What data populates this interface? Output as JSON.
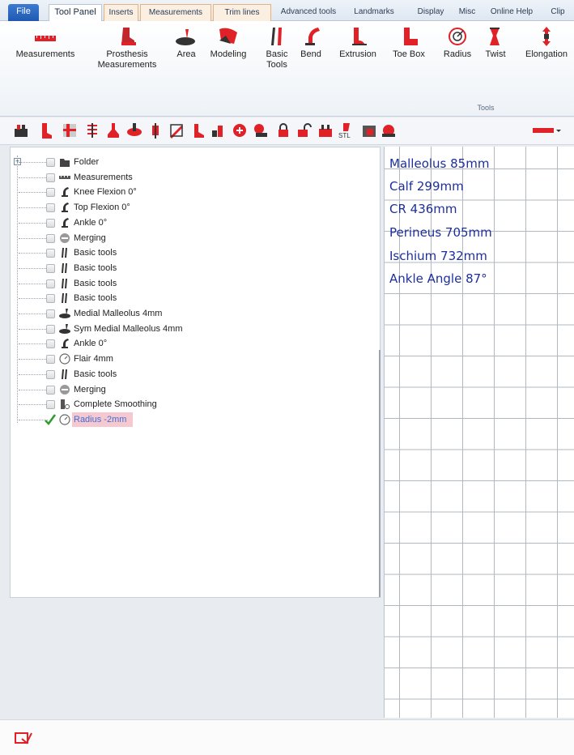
{
  "tabs": [
    {
      "id": "file",
      "label": "File"
    },
    {
      "id": "tool-panel",
      "label": "Tool Panel"
    },
    {
      "id": "inserts",
      "label": "Inserts"
    },
    {
      "id": "measurements",
      "label": "Measurements"
    },
    {
      "id": "trim-lines",
      "label": "Trim lines"
    },
    {
      "id": "advanced-tools",
      "label": "Advanced tools"
    },
    {
      "id": "landmarks",
      "label": "Landmarks"
    },
    {
      "id": "display",
      "label": "Display"
    },
    {
      "id": "misc",
      "label": "Misc"
    },
    {
      "id": "online-help",
      "label": "Online Help"
    },
    {
      "id": "clip",
      "label": "Clip"
    }
  ],
  "ribbon": {
    "buttons": [
      {
        "label": "Measurements",
        "icon": "measurements-icon"
      },
      {
        "label": "Prosthesis Measurements",
        "icon": "prosthesis-measurements-icon"
      },
      {
        "label": "Area",
        "icon": "area-icon"
      },
      {
        "label": "Modeling",
        "icon": "modeling-icon"
      },
      {
        "label": "Basic Tools",
        "icon": "basic-tools-icon"
      },
      {
        "label": "Bend",
        "icon": "bend-icon"
      },
      {
        "label": "Extrusion",
        "icon": "extrusion-icon"
      },
      {
        "label": "Toe Box",
        "icon": "toe-box-icon"
      },
      {
        "label": "Radius",
        "icon": "radius-icon"
      },
      {
        "label": "Twist",
        "icon": "twist-icon"
      },
      {
        "label": "Elongation",
        "icon": "elongation-icon"
      }
    ],
    "group_label": "Tools"
  },
  "toolbar": {
    "stl_label": "STL"
  },
  "tree": {
    "items": [
      {
        "label": "Folder",
        "icon": "folder-icon"
      },
      {
        "label": "Measurements",
        "icon": "measurements-icon"
      },
      {
        "label": "Knee Flexion   0°",
        "icon": "bend-icon"
      },
      {
        "label": "Top Flexion   0°",
        "icon": "bend-icon"
      },
      {
        "label": "Ankle   0°",
        "icon": "bend-icon"
      },
      {
        "label": "Merging",
        "icon": "merging-icon"
      },
      {
        "label": "Basic tools",
        "icon": "basic-tools-icon"
      },
      {
        "label": "Basic tools",
        "icon": "basic-tools-icon"
      },
      {
        "label": "Basic tools",
        "icon": "basic-tools-icon"
      },
      {
        "label": "Basic tools",
        "icon": "basic-tools-icon"
      },
      {
        "label": "Medial Malleolus   4mm",
        "icon": "area-icon"
      },
      {
        "label": "Sym Medial Malleolus   4mm",
        "icon": "area-icon"
      },
      {
        "label": "Ankle   0°",
        "icon": "bend-icon"
      },
      {
        "label": "Flair   4mm",
        "icon": "radius-icon"
      },
      {
        "label": "Basic tools",
        "icon": "basic-tools-icon"
      },
      {
        "label": "Merging",
        "icon": "merging-icon"
      },
      {
        "label": "Complete Smoothing",
        "icon": "smoothing-icon"
      },
      {
        "label": "Radius    -2mm",
        "icon": "radius-icon",
        "selected": true
      }
    ]
  },
  "measurements_sheet": {
    "lines": [
      "Malleolus 85mm",
      "Calf 299mm",
      "CR 436mm",
      "Perineus 705mm",
      "Ischium 732mm",
      "Ankle Angle 87°"
    ]
  },
  "colors": {
    "accent_red": "#e02128",
    "text_blue": "#1d2f9a",
    "selection": "#f6c8cf"
  }
}
